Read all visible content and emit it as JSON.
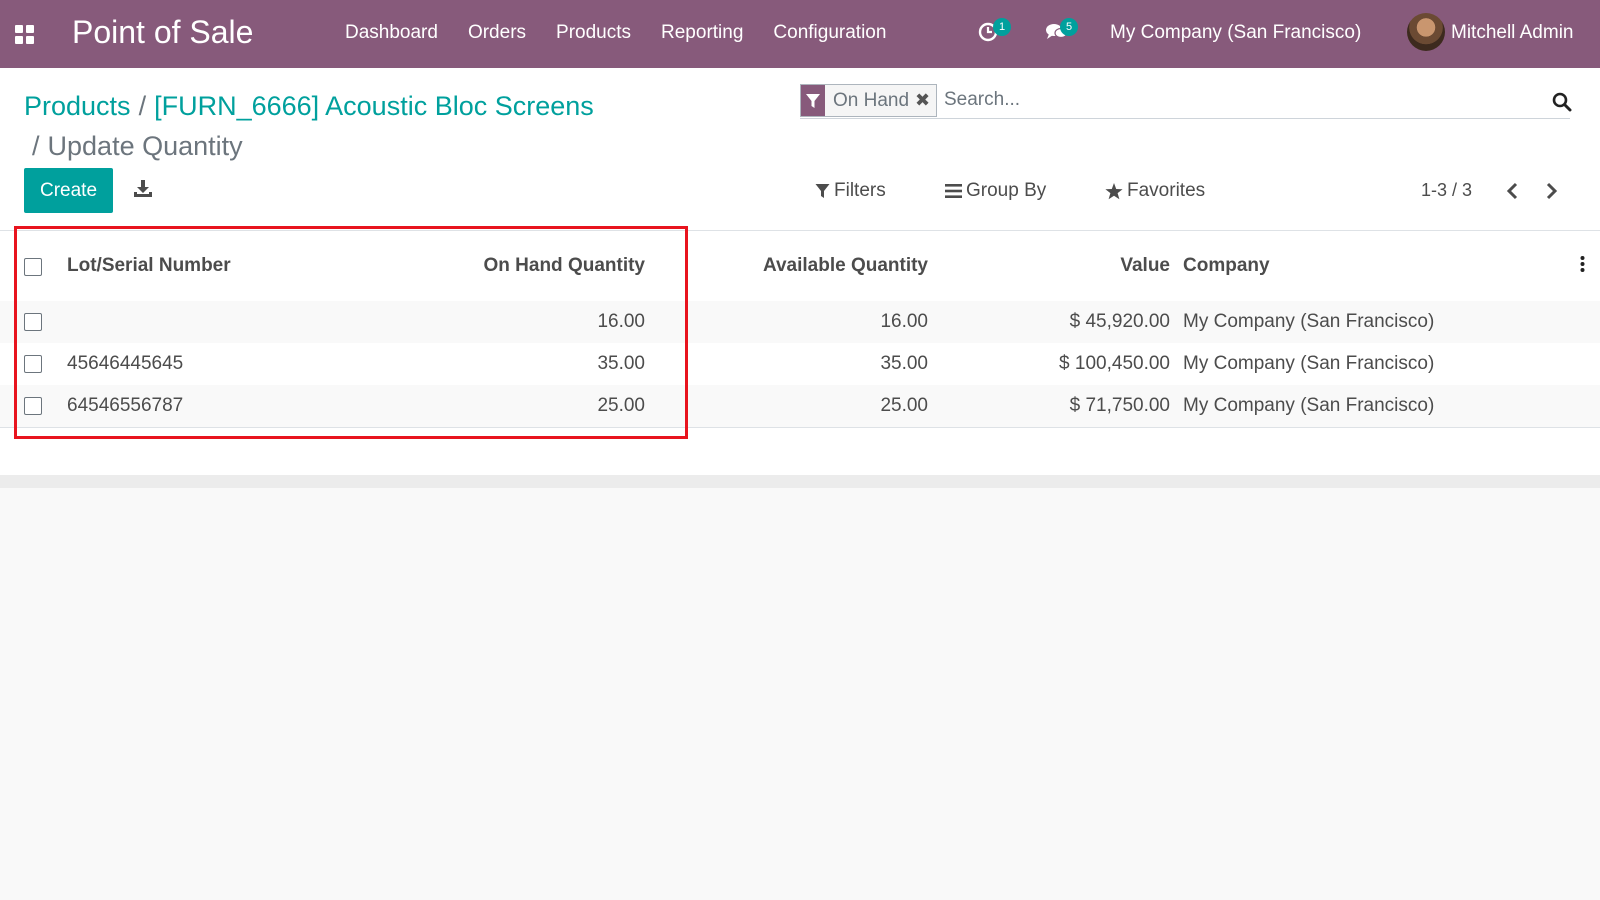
{
  "navbar": {
    "app_title": "Point of Sale",
    "menu": [
      "Dashboard",
      "Orders",
      "Products",
      "Reporting",
      "Configuration"
    ],
    "activity_count": "1",
    "message_count": "5",
    "company": "My Company (San Francisco)",
    "user": "Mitchell Admin"
  },
  "breadcrumb": {
    "products": "Products",
    "product": "[FURN_6666] Acoustic Bloc Screens",
    "current": "Update Quantity",
    "separator": "/"
  },
  "search": {
    "facet_label": "On Hand",
    "placeholder": "Search..."
  },
  "toolbar": {
    "create_label": "Create",
    "filters_label": "Filters",
    "groupby_label": "Group By",
    "favorites_label": "Favorites",
    "pager": "1-3 / 3"
  },
  "table": {
    "columns": {
      "lot": "Lot/Serial Number",
      "on_hand": "On Hand Quantity",
      "available": "Available Quantity",
      "value": "Value",
      "company": "Company"
    },
    "rows": [
      {
        "lot": "",
        "on_hand": "16.00",
        "available": "16.00",
        "value": "$ 45,920.00",
        "company": "My Company (San Francisco)"
      },
      {
        "lot": "45646445645",
        "on_hand": "35.00",
        "available": "35.00",
        "value": "$ 100,450.00",
        "company": "My Company (San Francisco)"
      },
      {
        "lot": "64546556787",
        "on_hand": "25.00",
        "available": "25.00",
        "value": "$ 71,750.00",
        "company": "My Company (San Francisco)"
      }
    ]
  },
  "colors": {
    "navbar": "#875a7b",
    "accent": "#00a09d",
    "highlight": "#e8141e"
  },
  "icons": [
    "apps-grid-icon",
    "activity-clock-icon",
    "chat-bubbles-icon",
    "search-icon",
    "filter-icon",
    "download-icon",
    "list-icon",
    "star-icon",
    "chevron-left-icon",
    "chevron-right-icon",
    "kebab-menu-icon",
    "close-icon"
  ]
}
